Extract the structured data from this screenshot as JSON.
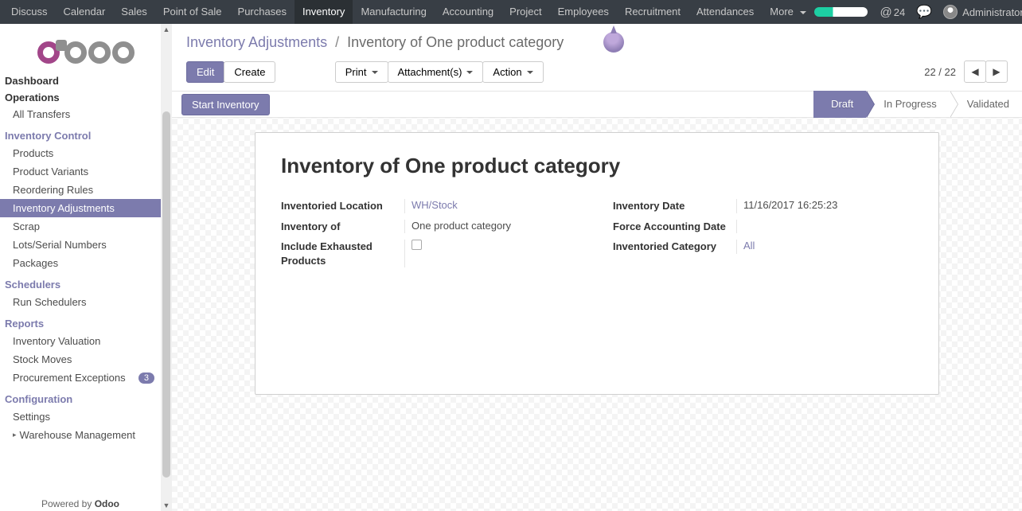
{
  "topnav": {
    "items": [
      "Discuss",
      "Calendar",
      "Sales",
      "Point of Sale",
      "Purchases",
      "Inventory",
      "Manufacturing",
      "Accounting",
      "Project",
      "Employees",
      "Recruitment",
      "Attendances"
    ],
    "more": "More",
    "active": "Inventory",
    "messages_count": "24",
    "user_name": "Administrator"
  },
  "sidebar": {
    "headers": {
      "dashboard": "Dashboard",
      "operations": "Operations"
    },
    "operations": [
      "All Transfers"
    ],
    "groups": [
      {
        "title": "Inventory Control",
        "items": [
          "Products",
          "Product Variants",
          "Reordering Rules",
          "Inventory Adjustments",
          "Scrap",
          "Lots/Serial Numbers",
          "Packages"
        ],
        "active": "Inventory Adjustments"
      },
      {
        "title": "Schedulers",
        "items": [
          "Run Schedulers"
        ]
      },
      {
        "title": "Reports",
        "items": [
          "Inventory Valuation",
          "Stock Moves",
          "Procurement Exceptions"
        ],
        "badges": {
          "Procurement Exceptions": "3"
        }
      },
      {
        "title": "Configuration",
        "items": [
          "Settings",
          "Warehouse Management"
        ],
        "parents": [
          "Warehouse Management"
        ]
      }
    ],
    "footer_prefix": "Powered by ",
    "footer_brand": "Odoo"
  },
  "breadcrumb": {
    "parent": "Inventory Adjustments",
    "current": "Inventory of One product category"
  },
  "toolbar": {
    "edit": "Edit",
    "create": "Create",
    "print": "Print",
    "attachments": "Attachment(s)",
    "action": "Action"
  },
  "pager": {
    "text": "22 / 22"
  },
  "statusbar": {
    "start": "Start Inventory",
    "stages": [
      "Draft",
      "In Progress",
      "Validated"
    ],
    "current": "Draft"
  },
  "form": {
    "title": "Inventory of One product category",
    "labels": {
      "location": "Inventoried Location",
      "inventory_of": "Inventory of",
      "exhausted": "Include Exhausted Products",
      "date": "Inventory Date",
      "force_date": "Force Accounting Date",
      "category": "Inventoried Category"
    },
    "values": {
      "location": "WH/Stock",
      "inventory_of": "One product category",
      "exhausted_checked": false,
      "date": "11/16/2017 16:25:23",
      "force_date": "",
      "category": "All"
    }
  }
}
